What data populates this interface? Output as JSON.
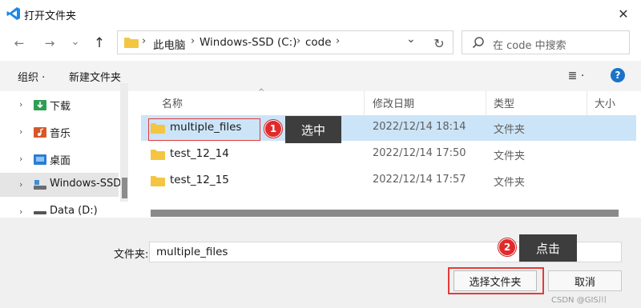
{
  "window": {
    "title": "打开文件夹",
    "close_glyph": "✕"
  },
  "nav": {
    "back": "←",
    "forward": "→",
    "recent": "⌄",
    "up": "↑"
  },
  "address": {
    "crumbs": [
      "此电脑",
      "Windows-SSD (C:)",
      "code"
    ],
    "separator": "›",
    "dropdown": "⌄",
    "refresh": "↻"
  },
  "search": {
    "placeholder": "在 code 中搜索"
  },
  "toolbar": {
    "organize": "组织 ·",
    "new_folder": "新建文件夹",
    "view": "≣ ·",
    "help": "?"
  },
  "sidebar": {
    "items": [
      {
        "label": "下载",
        "icon": "download-icon",
        "selected": false
      },
      {
        "label": "音乐",
        "icon": "music-icon",
        "selected": false
      },
      {
        "label": "桌面",
        "icon": "desktop-icon",
        "selected": false
      },
      {
        "label": "Windows-SSD",
        "icon": "drive-icon",
        "selected": true
      },
      {
        "label": "Data (D:)",
        "icon": "drive-icon",
        "selected": false
      }
    ],
    "chevron": "›"
  },
  "columns": {
    "name": "名称",
    "date": "修改日期",
    "type": "类型",
    "size": "大小",
    "sort_glyph": "^"
  },
  "files": [
    {
      "name": "multiple_files",
      "date": "2022/12/14 18:14",
      "type": "文件夹",
      "selected": true
    },
    {
      "name": "test_12_14",
      "date": "2022/12/14 17:50",
      "type": "文件夹",
      "selected": false
    },
    {
      "name": "test_12_15",
      "date": "2022/12/14 17:57",
      "type": "文件夹",
      "selected": false
    }
  ],
  "annotations": [
    {
      "number": "1",
      "text": "选中"
    },
    {
      "number": "2",
      "text": "点击"
    }
  ],
  "footer": {
    "folder_label": "文件夹:",
    "folder_value": "multiple_files",
    "select_button": "选择文件夹",
    "cancel_button": "取消"
  },
  "watermark": "CSDN @GIS川",
  "colors": {
    "accent": "#1a73c9",
    "selection": "#cce4f7",
    "highlight": "#e23b3b",
    "folder": "#f4c542"
  }
}
